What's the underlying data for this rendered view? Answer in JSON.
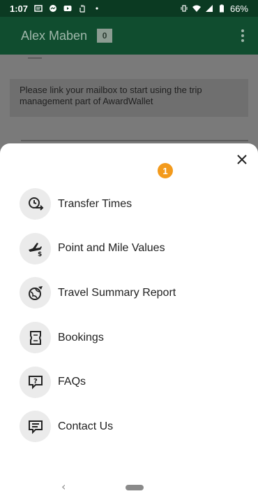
{
  "status_bar": {
    "time": "1:07",
    "battery": "66%",
    "notification_icons": [
      "message-icon",
      "messenger-icon",
      "youtube-icon",
      "hand-icon",
      "dot-icon"
    ],
    "system_icons": [
      "vibrate-icon",
      "wifi-icon",
      "signal-icon",
      "battery-icon"
    ]
  },
  "app_bar": {
    "title": "Alex Maben",
    "count": "0"
  },
  "page": {
    "notice": "Please link your mailbox to start using the trip management part of AwardWallet"
  },
  "sheet": {
    "step_badge": "1",
    "items": [
      {
        "label": "Transfer Times",
        "icon": "transfer-times-icon"
      },
      {
        "label": "Point and Mile Values",
        "icon": "plane-dollar-icon"
      },
      {
        "label": "Travel Summary Report",
        "icon": "globe-plane-icon"
      },
      {
        "label": "Bookings",
        "icon": "ticket-icon"
      },
      {
        "label": "FAQs",
        "icon": "question-bubble-icon"
      },
      {
        "label": "Contact Us",
        "icon": "chat-lines-icon"
      }
    ]
  },
  "nav_bar": {
    "back": "‹"
  }
}
